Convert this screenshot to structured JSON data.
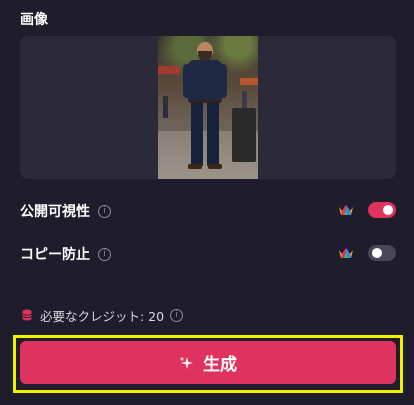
{
  "image_section": {
    "title": "画像"
  },
  "visibility": {
    "label": "公開可視性",
    "info": "i",
    "enabled": true
  },
  "copy_protection": {
    "label": "コピー防止",
    "info": "i",
    "enabled": false
  },
  "credits": {
    "text": "必要なクレジット: 20",
    "info": "i"
  },
  "generate": {
    "label": "生成"
  },
  "colors": {
    "accent": "#e0325e",
    "background": "#1f1d2b",
    "panel": "#2c2a3a",
    "highlight": "#f0f000"
  }
}
